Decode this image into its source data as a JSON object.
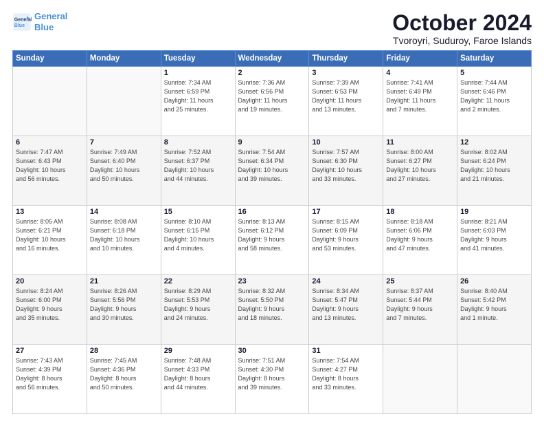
{
  "logo": {
    "line1": "General",
    "line2": "Blue"
  },
  "header": {
    "month": "October 2024",
    "location": "Tvoroyri, Suduroy, Faroe Islands"
  },
  "weekdays": [
    "Sunday",
    "Monday",
    "Tuesday",
    "Wednesday",
    "Thursday",
    "Friday",
    "Saturday"
  ],
  "weeks": [
    [
      {
        "day": "",
        "info": ""
      },
      {
        "day": "",
        "info": ""
      },
      {
        "day": "1",
        "info": "Sunrise: 7:34 AM\nSunset: 6:59 PM\nDaylight: 11 hours\nand 25 minutes."
      },
      {
        "day": "2",
        "info": "Sunrise: 7:36 AM\nSunset: 6:56 PM\nDaylight: 11 hours\nand 19 minutes."
      },
      {
        "day": "3",
        "info": "Sunrise: 7:39 AM\nSunset: 6:53 PM\nDaylight: 11 hours\nand 13 minutes."
      },
      {
        "day": "4",
        "info": "Sunrise: 7:41 AM\nSunset: 6:49 PM\nDaylight: 11 hours\nand 7 minutes."
      },
      {
        "day": "5",
        "info": "Sunrise: 7:44 AM\nSunset: 6:46 PM\nDaylight: 11 hours\nand 2 minutes."
      }
    ],
    [
      {
        "day": "6",
        "info": "Sunrise: 7:47 AM\nSunset: 6:43 PM\nDaylight: 10 hours\nand 56 minutes."
      },
      {
        "day": "7",
        "info": "Sunrise: 7:49 AM\nSunset: 6:40 PM\nDaylight: 10 hours\nand 50 minutes."
      },
      {
        "day": "8",
        "info": "Sunrise: 7:52 AM\nSunset: 6:37 PM\nDaylight: 10 hours\nand 44 minutes."
      },
      {
        "day": "9",
        "info": "Sunrise: 7:54 AM\nSunset: 6:34 PM\nDaylight: 10 hours\nand 39 minutes."
      },
      {
        "day": "10",
        "info": "Sunrise: 7:57 AM\nSunset: 6:30 PM\nDaylight: 10 hours\nand 33 minutes."
      },
      {
        "day": "11",
        "info": "Sunrise: 8:00 AM\nSunset: 6:27 PM\nDaylight: 10 hours\nand 27 minutes."
      },
      {
        "day": "12",
        "info": "Sunrise: 8:02 AM\nSunset: 6:24 PM\nDaylight: 10 hours\nand 21 minutes."
      }
    ],
    [
      {
        "day": "13",
        "info": "Sunrise: 8:05 AM\nSunset: 6:21 PM\nDaylight: 10 hours\nand 16 minutes."
      },
      {
        "day": "14",
        "info": "Sunrise: 8:08 AM\nSunset: 6:18 PM\nDaylight: 10 hours\nand 10 minutes."
      },
      {
        "day": "15",
        "info": "Sunrise: 8:10 AM\nSunset: 6:15 PM\nDaylight: 10 hours\nand 4 minutes."
      },
      {
        "day": "16",
        "info": "Sunrise: 8:13 AM\nSunset: 6:12 PM\nDaylight: 9 hours\nand 58 minutes."
      },
      {
        "day": "17",
        "info": "Sunrise: 8:15 AM\nSunset: 6:09 PM\nDaylight: 9 hours\nand 53 minutes."
      },
      {
        "day": "18",
        "info": "Sunrise: 8:18 AM\nSunset: 6:06 PM\nDaylight: 9 hours\nand 47 minutes."
      },
      {
        "day": "19",
        "info": "Sunrise: 8:21 AM\nSunset: 6:03 PM\nDaylight: 9 hours\nand 41 minutes."
      }
    ],
    [
      {
        "day": "20",
        "info": "Sunrise: 8:24 AM\nSunset: 6:00 PM\nDaylight: 9 hours\nand 35 minutes."
      },
      {
        "day": "21",
        "info": "Sunrise: 8:26 AM\nSunset: 5:56 PM\nDaylight: 9 hours\nand 30 minutes."
      },
      {
        "day": "22",
        "info": "Sunrise: 8:29 AM\nSunset: 5:53 PM\nDaylight: 9 hours\nand 24 minutes."
      },
      {
        "day": "23",
        "info": "Sunrise: 8:32 AM\nSunset: 5:50 PM\nDaylight: 9 hours\nand 18 minutes."
      },
      {
        "day": "24",
        "info": "Sunrise: 8:34 AM\nSunset: 5:47 PM\nDaylight: 9 hours\nand 13 minutes."
      },
      {
        "day": "25",
        "info": "Sunrise: 8:37 AM\nSunset: 5:44 PM\nDaylight: 9 hours\nand 7 minutes."
      },
      {
        "day": "26",
        "info": "Sunrise: 8:40 AM\nSunset: 5:42 PM\nDaylight: 9 hours\nand 1 minute."
      }
    ],
    [
      {
        "day": "27",
        "info": "Sunrise: 7:43 AM\nSunset: 4:39 PM\nDaylight: 8 hours\nand 56 minutes."
      },
      {
        "day": "28",
        "info": "Sunrise: 7:45 AM\nSunset: 4:36 PM\nDaylight: 8 hours\nand 50 minutes."
      },
      {
        "day": "29",
        "info": "Sunrise: 7:48 AM\nSunset: 4:33 PM\nDaylight: 8 hours\nand 44 minutes."
      },
      {
        "day": "30",
        "info": "Sunrise: 7:51 AM\nSunset: 4:30 PM\nDaylight: 8 hours\nand 39 minutes."
      },
      {
        "day": "31",
        "info": "Sunrise: 7:54 AM\nSunset: 4:27 PM\nDaylight: 8 hours\nand 33 minutes."
      },
      {
        "day": "",
        "info": ""
      },
      {
        "day": "",
        "info": ""
      }
    ]
  ]
}
